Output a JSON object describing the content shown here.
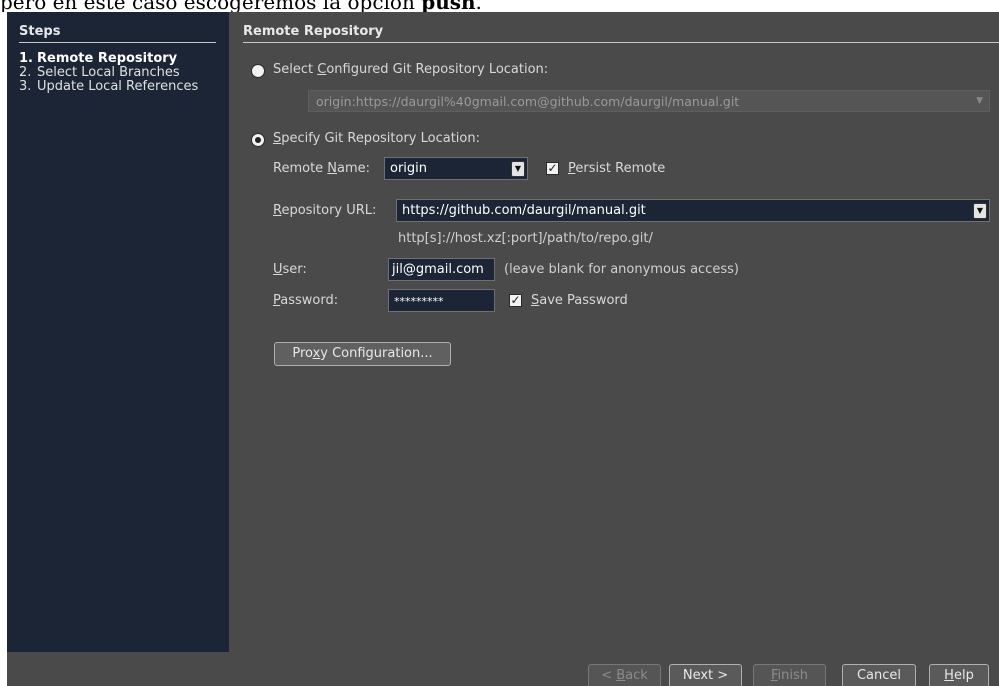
{
  "doc_text": {
    "before": "pero en este caso escogeremos la opción ",
    "bold": "push",
    "after": "."
  },
  "steps": {
    "title": "Steps",
    "items": [
      {
        "num": "1.",
        "label": "Remote Repository",
        "current": true
      },
      {
        "num": "2.",
        "label": "Select Local Branches",
        "current": false
      },
      {
        "num": "3.",
        "label": "Update Local References",
        "current": false
      }
    ]
  },
  "content": {
    "title": "Remote Repository",
    "configured": {
      "label": "Select Configured Git Repository Location:",
      "selected": false,
      "value": "origin:https://daurgil%40gmail.com@github.com/daurgil/manual.git"
    },
    "specify": {
      "label": "Specify Git Repository Location:",
      "selected": true
    },
    "remote_name": {
      "label": "Remote Name:",
      "value": "origin"
    },
    "persist_remote": {
      "label": "Persist Remote",
      "checked": true
    },
    "repo_url": {
      "label": "Repository URL:",
      "value": "https://github.com/daurgil/manual.git",
      "hint": "http[s]://host.xz[:port]/path/to/repo.git/"
    },
    "user": {
      "label": "User:",
      "value": "jil@gmail.com",
      "hint": "(leave blank for anonymous access)"
    },
    "password": {
      "label": "Password:",
      "value": "*********"
    },
    "save_password": {
      "label": "Save Password",
      "checked": true
    },
    "proxy_button": "Proxy Configuration..."
  },
  "footer": {
    "back": "< Back",
    "next": "Next >",
    "finish": "Finish",
    "cancel": "Cancel",
    "help": "Help"
  }
}
